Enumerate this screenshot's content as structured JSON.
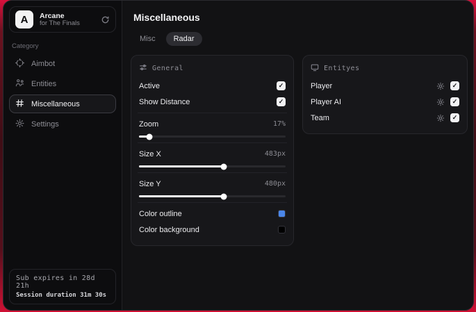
{
  "sidebar": {
    "logo": {
      "initial": "A",
      "title": "Arcane",
      "subtitle": "for The Finals"
    },
    "category_label": "Category",
    "items": [
      {
        "label": "Aimbot",
        "icon": "crosshair-icon",
        "active": false
      },
      {
        "label": "Entities",
        "icon": "entities-icon",
        "active": false
      },
      {
        "label": "Miscellaneous",
        "icon": "grid-hash-icon",
        "active": true
      },
      {
        "label": "Settings",
        "icon": "gear-icon",
        "active": false
      }
    ],
    "subscription": {
      "expires": "Sub expires in 28d 21h",
      "session": "Session duration 31m 30s"
    }
  },
  "main": {
    "title": "Miscellaneous",
    "tabs": [
      {
        "label": "Misc",
        "active": false
      },
      {
        "label": "Radar",
        "active": true
      }
    ],
    "panels": {
      "general": {
        "header": "General",
        "toggles": [
          {
            "label": "Active",
            "checked": true
          },
          {
            "label": "Show Distance",
            "checked": true
          }
        ],
        "sliders": [
          {
            "label": "Zoom",
            "value": "17%",
            "pct": 7
          },
          {
            "label": "Size X",
            "value": "483px",
            "pct": 58
          },
          {
            "label": "Size Y",
            "value": "480px",
            "pct": 58
          }
        ],
        "colors": [
          {
            "label": "Color outline",
            "swatch": "#4a86e8"
          },
          {
            "label": "Color background",
            "swatch": "#000000"
          }
        ]
      },
      "entities": {
        "header": "Entityes",
        "rows": [
          {
            "label": "Player",
            "checked": true
          },
          {
            "label": "Player AI",
            "checked": true
          },
          {
            "label": "Team",
            "checked": true
          }
        ]
      }
    }
  },
  "colors": {
    "backdrop_red": "#d8103c",
    "swatch_blue": "#4a86e8",
    "swatch_black": "#000000"
  }
}
